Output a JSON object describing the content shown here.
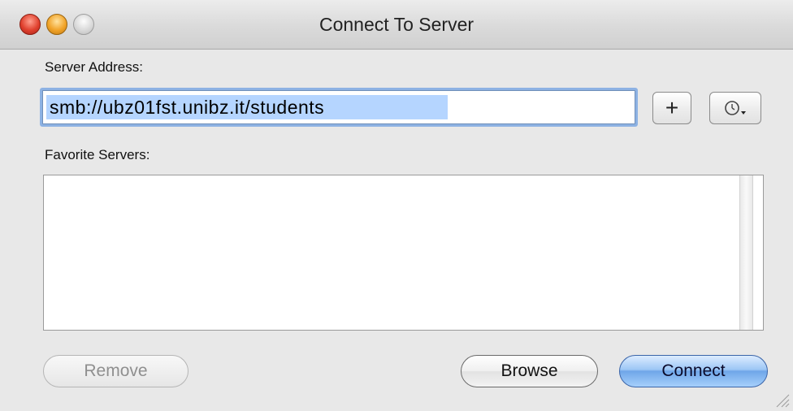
{
  "window": {
    "title": "Connect To Server"
  },
  "form": {
    "server_address_label": "Server Address:",
    "server_address_value": "smb://ubz01fst.unibz.it/students",
    "add_button_label": "+",
    "favorites_label": "Favorite Servers:",
    "favorites_items": []
  },
  "buttons": {
    "remove": "Remove",
    "browse": "Browse",
    "connect": "Connect"
  },
  "icons": {
    "window_controls": [
      "close-icon",
      "minimize-icon",
      "zoom-icon"
    ],
    "recent_servers": "clock-icon",
    "resize": "resize-grip-icon"
  },
  "colors": {
    "selection_highlight": "#b5d5ff",
    "focus_ring": "#8db2e3",
    "default_button": "#6fa6e8"
  }
}
